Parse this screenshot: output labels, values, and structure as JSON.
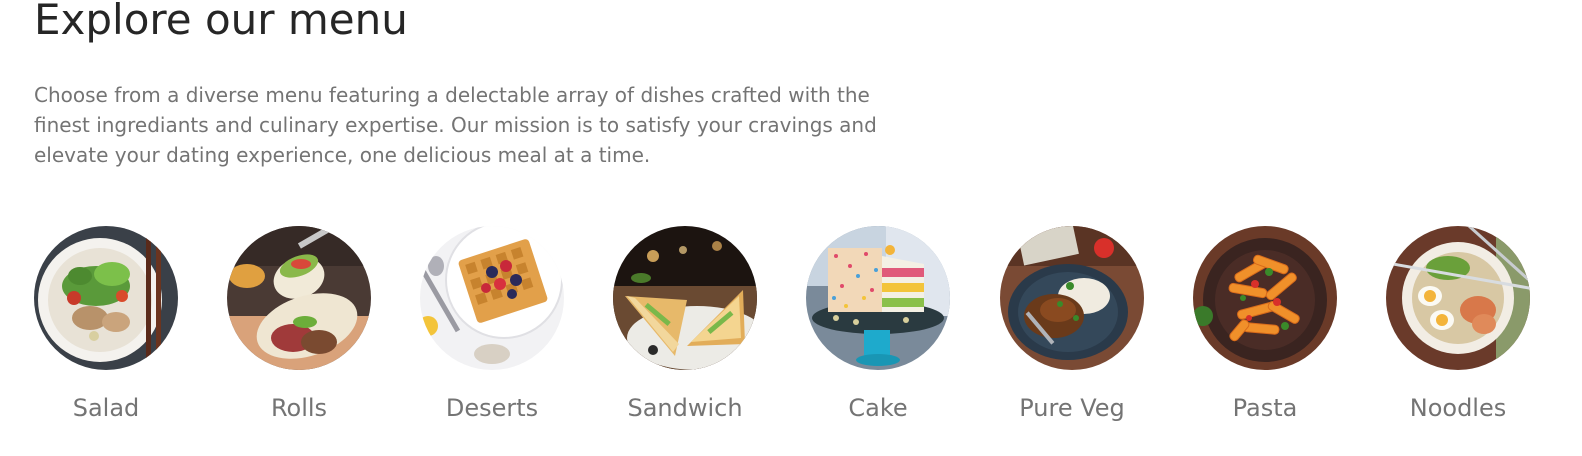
{
  "header": {
    "title": "Explore our menu",
    "description": "Choose from a diverse menu featuring a delectable array of dishes crafted with the finest ingrediants and culinary expertise. Our mission is to satisfy your cravings and elevate your dating experience, one delicious meal at a time."
  },
  "menu": {
    "items": [
      {
        "label": "Salad",
        "icon": "salad-image"
      },
      {
        "label": "Rolls",
        "icon": "rolls-image"
      },
      {
        "label": "Deserts",
        "icon": "deserts-image"
      },
      {
        "label": "Sandwich",
        "icon": "sandwich-image"
      },
      {
        "label": "Cake",
        "icon": "cake-image"
      },
      {
        "label": "Pure Veg",
        "icon": "pure-veg-image"
      },
      {
        "label": "Pasta",
        "icon": "pasta-image"
      },
      {
        "label": "Noodles",
        "icon": "noodles-image"
      }
    ]
  },
  "colors": {
    "title": "#262626",
    "text": "#747474"
  }
}
